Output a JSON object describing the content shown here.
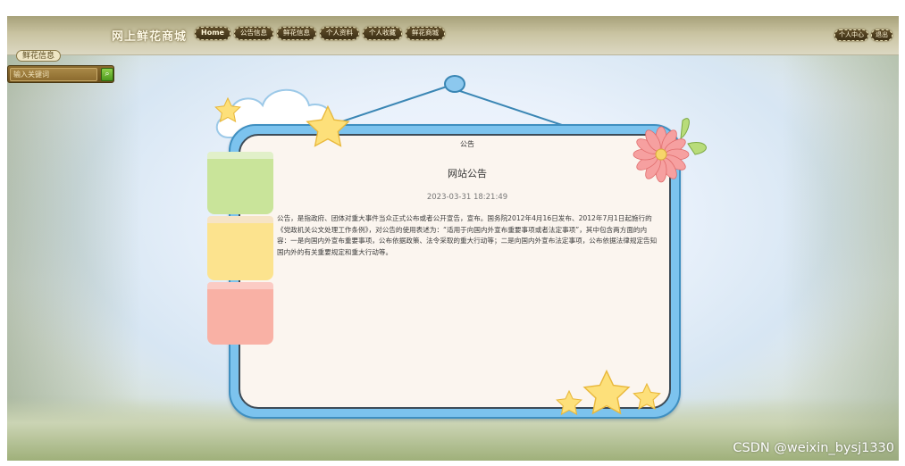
{
  "header": {
    "site_title": "网上鲜花商城",
    "nav": [
      "Home",
      "公告信息",
      "鲜花信息",
      "个人资料",
      "个人收藏",
      "鲜花商城"
    ],
    "right_buttons": [
      "个人中心",
      "退出"
    ]
  },
  "sidebar": {
    "category_label": "鲜花信息",
    "search_placeholder": "输入关键词"
  },
  "notice": {
    "heading": "公告",
    "title": "网站公告",
    "time": "2023-03-31 18:21:49",
    "body": "公告，是指政府、团体对重大事件当众正式公布或者公开宣告，宣布。国务院2012年4月16日发布、2012年7月1日起施行的《党政机关公文处理工作条例》，对公告的使用表述为：“适用于向国内外宣布重要事项或者法定事项”，其中包含两方面的内容：一是向国内外宣布重要事项，公布依据政策、法令采取的重大行动等；二是向国内外宣布法定事项，公布依据法律规定告知国内外的有关重要规定和重大行动等。"
  },
  "watermark": "CSDN @weixin_bysj1330",
  "colors": {
    "board_blue": "#7cc3ee",
    "board_inner": "#fbf5ef",
    "nav_button": "#4a3a1c"
  }
}
